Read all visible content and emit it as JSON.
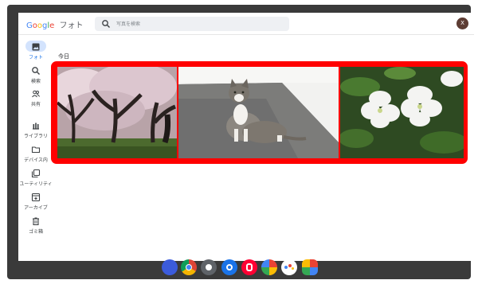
{
  "header": {
    "logo_letters": [
      "G",
      "o",
      "o",
      "g",
      "l",
      "e"
    ],
    "product": "フォト",
    "search_placeholder": "写真を検索",
    "avatar_initial": "X"
  },
  "sidebar": {
    "items": [
      {
        "label": "フォト",
        "icon": "photo-icon",
        "active": true
      },
      {
        "label": "検索",
        "icon": "search-icon"
      },
      {
        "label": "共有",
        "icon": "people-icon"
      },
      {
        "label": "ライブラリ",
        "icon": "library-icon"
      },
      {
        "label": "デバイス内",
        "icon": "folder-icon"
      },
      {
        "label": "ユーティリティ",
        "icon": "utilities-icon"
      },
      {
        "label": "アーカイブ",
        "icon": "archive-icon"
      },
      {
        "label": "ゴミ箱",
        "icon": "trash-icon"
      }
    ]
  },
  "main": {
    "date_header": "今日",
    "photos": [
      {
        "name": "photo-cherry-blossom-trees"
      },
      {
        "name": "photo-cat"
      },
      {
        "name": "photo-white-flowers"
      }
    ]
  },
  "dock": {
    "apps": [
      {
        "name": "launcher-icon",
        "color": "#3b5bdb"
      },
      {
        "name": "chrome-icon",
        "color": "#db4437"
      },
      {
        "name": "camera-icon",
        "color": "#5f6368"
      },
      {
        "name": "settings-icon",
        "color": "#1a73e8"
      },
      {
        "name": "paypay-icon",
        "color": "#ff0033"
      },
      {
        "name": "photos-app-icon",
        "color": "#fbbc05"
      },
      {
        "name": "assistant-icon",
        "color": "#4285f4"
      },
      {
        "name": "apps-icon",
        "color": "#34a853"
      }
    ]
  }
}
